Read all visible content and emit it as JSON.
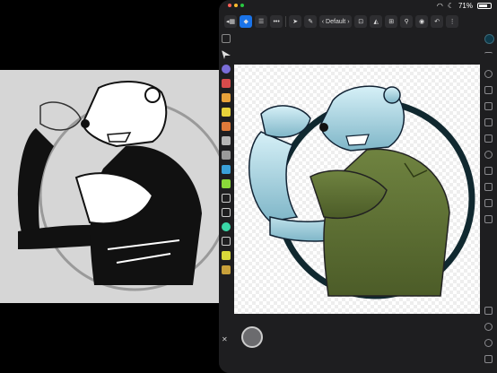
{
  "status": {
    "battery": "71%"
  },
  "toolbar": {
    "preset_label": "Default"
  },
  "colors": {
    "accent": "#1a73e8",
    "swatch": "#0f3a4a",
    "ring": "#10282f",
    "shirt": "#5d6f33",
    "bear_light": "#bfe5f0",
    "bear_dark": "#7fb6c8"
  },
  "icons": [
    "persona-icon",
    "menu-icon",
    "more-icon",
    "move-icon",
    "paint-icon",
    "chevron-left-icon",
    "chevron-right-icon",
    "snap-icon",
    "flip-icon",
    "zoom-icon",
    "view-icon",
    "undo-icon",
    "close-icon"
  ]
}
